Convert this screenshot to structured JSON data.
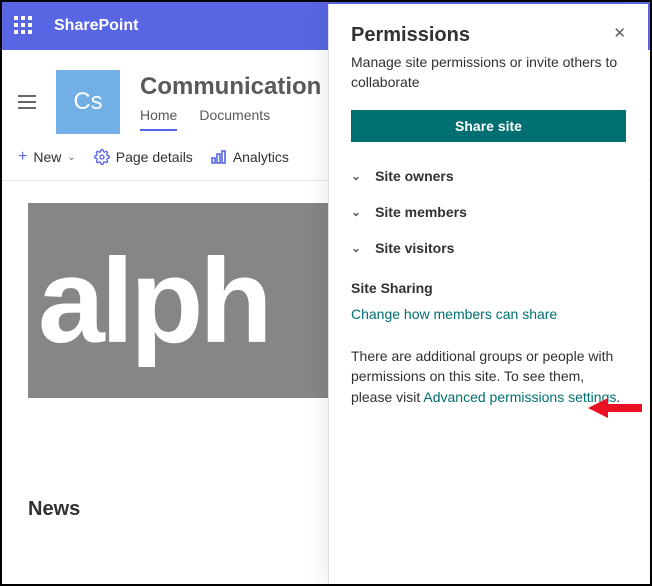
{
  "suite": {
    "brand": "SharePoint"
  },
  "site": {
    "logo_initials": "Cs",
    "title": "Communication",
    "nav": {
      "home": "Home",
      "documents": "Documents"
    }
  },
  "cmdbar": {
    "new": "New",
    "page_details": "Page details",
    "analytics": "Analytics"
  },
  "hero": {
    "text": "alph"
  },
  "news_heading": "News",
  "panel": {
    "title": "Permissions",
    "subtitle": "Manage site permissions or invite others to collaborate",
    "share_btn": "Share site",
    "groups": {
      "owners": "Site owners",
      "members": "Site members",
      "visitors": "Site visitors"
    },
    "site_sharing_heading": "Site Sharing",
    "change_share_link": "Change how members can share",
    "additional_text_pre": "There are additional groups or people with permissions on this site. To see them, please visit ",
    "additional_link": "Advanced permissions settings",
    "additional_text_post": "."
  }
}
